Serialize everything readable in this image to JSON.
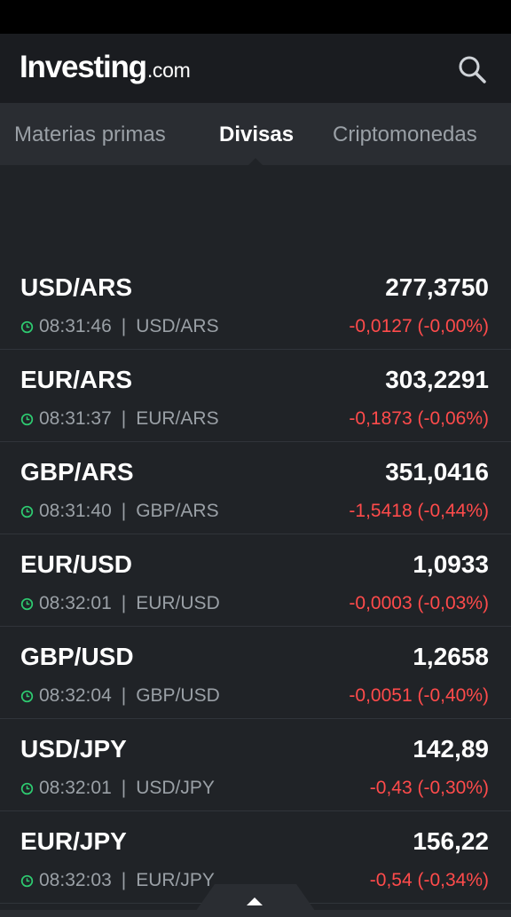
{
  "header": {
    "logo_main": "Investing",
    "logo_domain": ".com",
    "search_icon": "search-icon"
  },
  "tabs": [
    {
      "label": "Materias primas",
      "active": false
    },
    {
      "label": "Divisas",
      "active": true
    },
    {
      "label": "Criptomonedas",
      "active": false
    }
  ],
  "colors": {
    "negative": "#ff4b4b",
    "clock": "#2ecc71",
    "background": "#202327",
    "header": "#1a1c20"
  },
  "quotes": [
    {
      "pair": "USD/ARS",
      "price": "277,3750",
      "time": "08:31:46",
      "symbol": "USD/ARS",
      "change": "-0,0127 (-0,00%)"
    },
    {
      "pair": "EUR/ARS",
      "price": "303,2291",
      "time": "08:31:37",
      "symbol": "EUR/ARS",
      "change": "-0,1873 (-0,06%)"
    },
    {
      "pair": "GBP/ARS",
      "price": "351,0416",
      "time": "08:31:40",
      "symbol": "GBP/ARS",
      "change": "-1,5418 (-0,44%)"
    },
    {
      "pair": "EUR/USD",
      "price": "1,0933",
      "time": "08:32:01",
      "symbol": "EUR/USD",
      "change": "-0,0003 (-0,03%)"
    },
    {
      "pair": "GBP/USD",
      "price": "1,2658",
      "time": "08:32:04",
      "symbol": "GBP/USD",
      "change": "-0,0051 (-0,40%)"
    },
    {
      "pair": "USD/JPY",
      "price": "142,89",
      "time": "08:32:01",
      "symbol": "USD/JPY",
      "change": "-0,43 (-0,30%)"
    },
    {
      "pair": "EUR/JPY",
      "price": "156,22",
      "time": "08:32:03",
      "symbol": "EUR/JPY",
      "change": "-0,54 (-0,34%)"
    }
  ],
  "separator": "|"
}
